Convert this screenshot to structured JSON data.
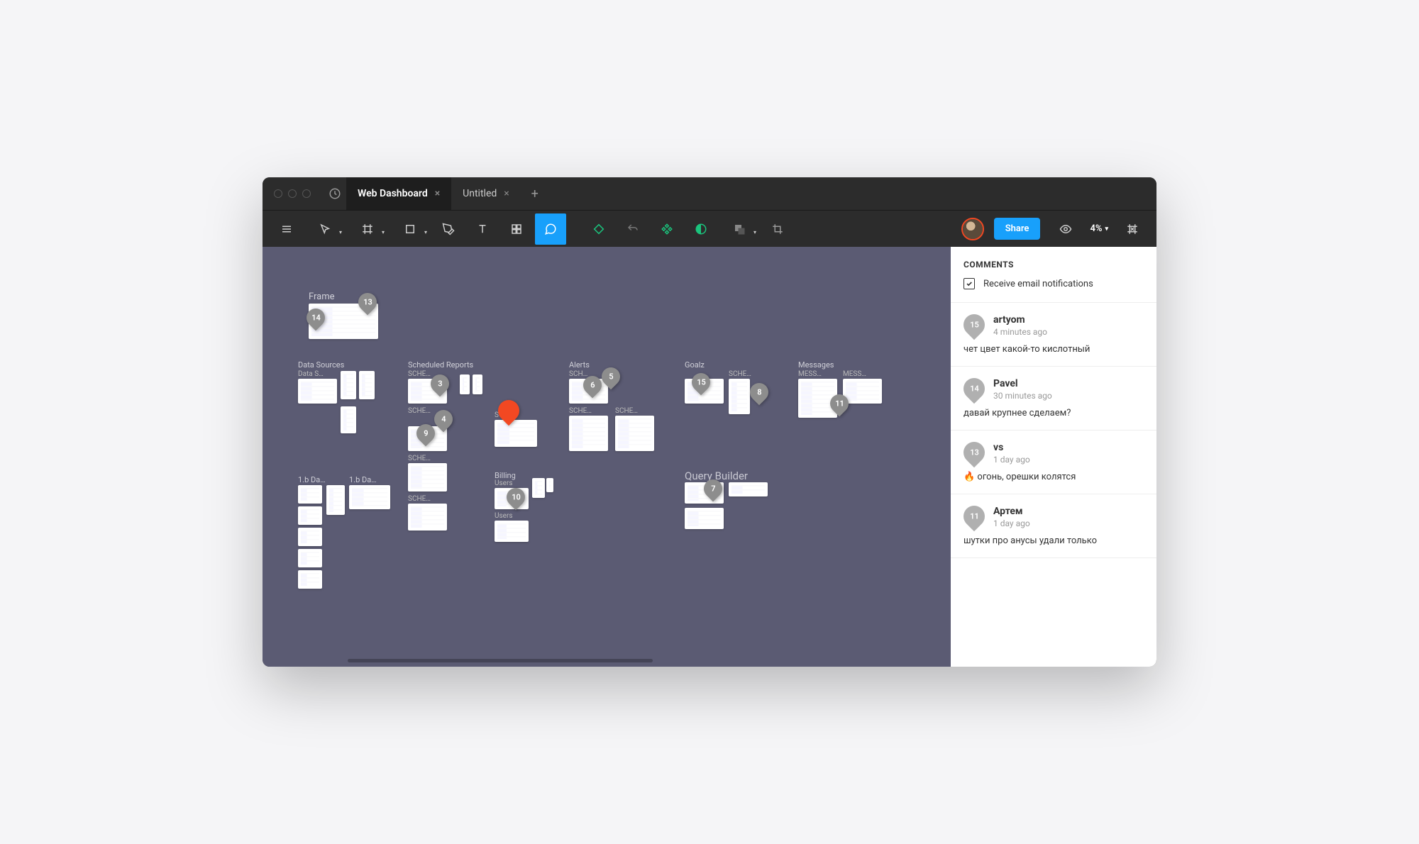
{
  "tabs": [
    {
      "label": "Web Dashboard",
      "active": true
    },
    {
      "label": "Untitled",
      "active": false
    }
  ],
  "toolbar": {
    "share_label": "Share",
    "zoom_label": "4%"
  },
  "canvas": {
    "frame_label": "Frame",
    "groups": {
      "data_sources": "Data Sources",
      "scheduled_reports": "Scheduled Reports",
      "alerts": "Alerts",
      "goalz": "Goalz",
      "messages": "Messages",
      "billing": "Billing",
      "query_builder": "Query Builder",
      "d1": "1.b Da…",
      "d2": "1.b Da…"
    },
    "thumb_labels": {
      "data_s": "Data S…",
      "sche1": "SCHE…",
      "sche2": "SCHE…",
      "sche3": "SCHE…",
      "sche4": "SCHE…",
      "sche5": "SCHE…",
      "sche6": "SCHE…",
      "sche7": "SCHE…",
      "sche_alerts1": "SCH…",
      "sche_alerts2": "SCHE…",
      "sche_goalz": "SCHE…",
      "mess1": "MESS…",
      "mess2": "MESS…",
      "users": "Users"
    },
    "pins": {
      "p3": "3",
      "p4": "4",
      "p5": "5",
      "p6": "6",
      "p7": "7",
      "p8": "8",
      "p9": "9",
      "p10": "10",
      "p11": "11",
      "p13": "13",
      "p14": "14",
      "p15": "15"
    }
  },
  "comments_panel": {
    "title": "COMMENTS",
    "notif_label": "Receive email notifications",
    "items": [
      {
        "pin": "15",
        "author": "artyom",
        "time": "4 minutes ago",
        "body": "чет цвет какой-то кислотный"
      },
      {
        "pin": "14",
        "author": "Pavel",
        "time": "30 minutes ago",
        "body": "давай крупнее сделаем?"
      },
      {
        "pin": "13",
        "author": "vs",
        "time": "1 day ago",
        "body": "🔥 огонь, орешки колятся"
      },
      {
        "pin": "11",
        "author": "Артем",
        "time": "1 day ago",
        "body": "шутки про анусы удали только"
      }
    ]
  }
}
